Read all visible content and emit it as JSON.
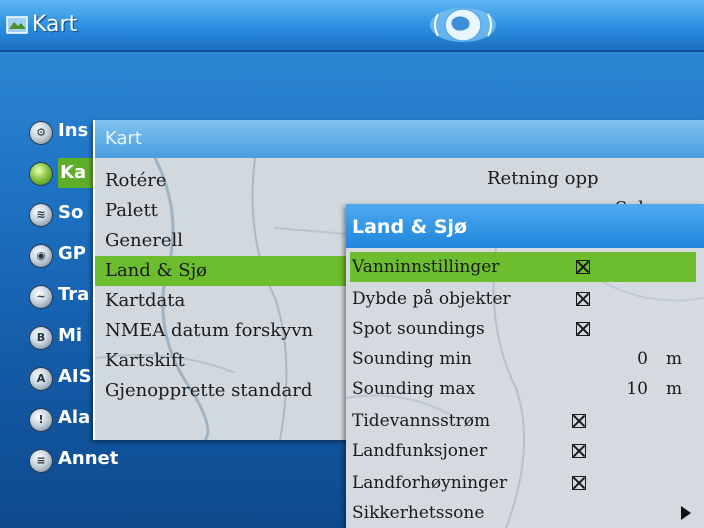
{
  "title_bar": {
    "title": "Kart",
    "app_icon": "map-icon",
    "globe_icon": "globe-icon"
  },
  "main_menu": {
    "items": [
      {
        "label": "Ins",
        "icon": "gear-icon"
      },
      {
        "label": "Ka",
        "icon": "map-icon",
        "selected": true
      },
      {
        "label": "So",
        "icon": "sonar-icon"
      },
      {
        "label": "GP",
        "icon": "gps-icon"
      },
      {
        "label": "Tra",
        "icon": "track-icon"
      },
      {
        "label": "Mi",
        "icon": "mob-icon"
      },
      {
        "label": "AIS",
        "icon": "ais-icon"
      },
      {
        "label": "Ala",
        "icon": "alarm-icon"
      },
      {
        "label": "Annet",
        "icon": "misc-icon"
      }
    ]
  },
  "kart_panel": {
    "header": "Kart",
    "items": [
      {
        "label": "Rotére",
        "value": "Retning opp"
      },
      {
        "label": "Palett",
        "value": ""
      },
      {
        "label": "Generell",
        "value": ""
      },
      {
        "label": "Land & Sjø",
        "selected": true
      },
      {
        "label": "Kartdata"
      },
      {
        "label": "NMEA datum forskyvn"
      },
      {
        "label": "Kartskift"
      },
      {
        "label": "Gjenopprette standard"
      }
    ],
    "palett_value_fragment": "Sol"
  },
  "land_sjo_panel": {
    "header": "Land & Sjø",
    "rows": [
      {
        "label": "Vanninnstillinger",
        "checked": true,
        "selected": true
      },
      {
        "label": "Dybde på objekter",
        "checked": true
      },
      {
        "label": "Spot soundings",
        "checked": true
      },
      {
        "label": "Sounding min",
        "number": "0",
        "unit": "m"
      },
      {
        "label": "Sounding max",
        "number": "10",
        "unit": "m"
      },
      {
        "label": "Tidevannsstrøm",
        "checked": true
      },
      {
        "label": "Landfunksjoner",
        "checked": true
      },
      {
        "label": "Landforhøyninger",
        "checked": true
      },
      {
        "label": "Sikkerhetssone",
        "submenu": true
      }
    ]
  },
  "colors": {
    "accent_green": "#6cbe2e",
    "header_blue": "#1f85dc",
    "background_blue": "#1f73c4"
  }
}
